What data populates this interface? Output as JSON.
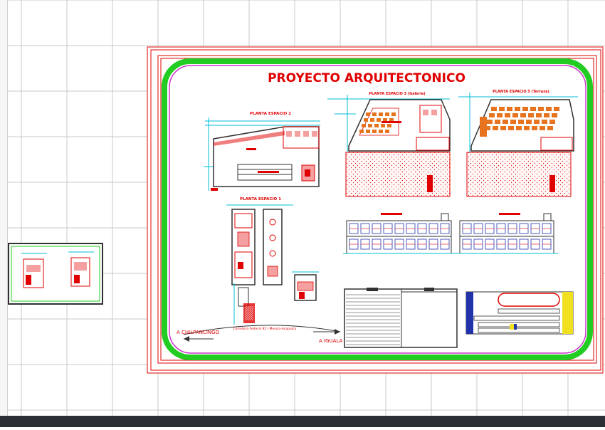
{
  "drawing": {
    "title": "PROYECTO ARQUITECTONICO",
    "plan_labels": {
      "planta_2": "PLANTA ESPACIO 2",
      "planta_3": "PLANTA ESPACIO 3 (Galeria)",
      "planta_5": "PLANTA ESPACIO 5 (Terraza)",
      "planta_1": "PLANTA ESPACIO 1"
    },
    "road": {
      "left_label": "A CHILPANCINGO",
      "center_label": "Carretera Federal 95 I Mexico-Acapulco",
      "right_label": "A IGUALA"
    }
  },
  "colors": {
    "canvas": "#ffffff",
    "grid": "#c8c8c8",
    "frame_red": "#e00000",
    "magenta": "#cc33cc",
    "green_corner": "#22cc22",
    "cyan_dim": "#00bcd4",
    "dark_line": "#303030",
    "orange_seat": "#e8731e",
    "blue_block": "#2233aa",
    "yellow_block": "#f0e020",
    "statusbar": "#2b2f36"
  }
}
